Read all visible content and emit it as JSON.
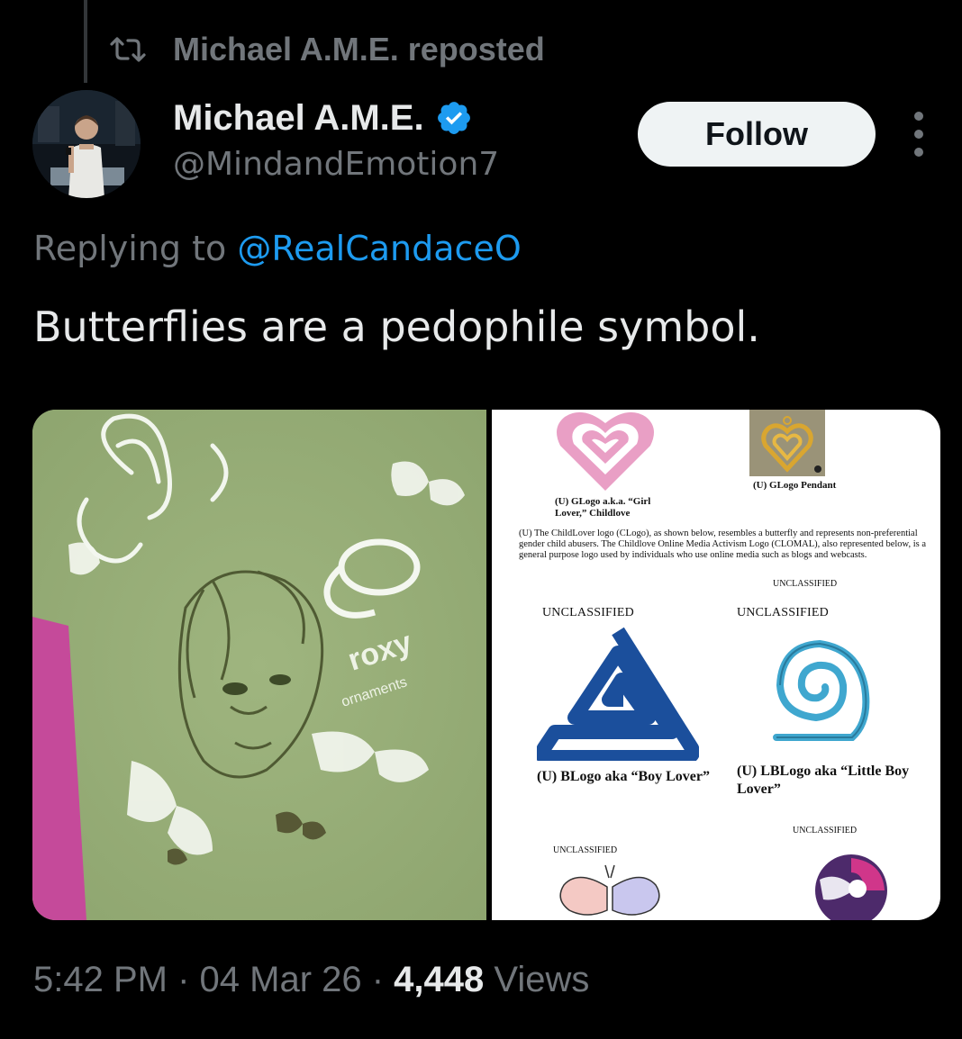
{
  "repost": {
    "text": "Michael A.M.E. reposted"
  },
  "author": {
    "display_name": "Michael A.M.E.",
    "handle": "@MindandEmotion7"
  },
  "follow_label": "Follow",
  "reply": {
    "prefix": "Replying to ",
    "mention": "@RealCandaceO"
  },
  "tweet_text": "Butterflies are a pedophile symbol.",
  "media": {
    "right": {
      "caption_glogo": "(U) GLogo a.k.a. “Girl Lover,” Childlove",
      "caption_pendant": "(U) GLogo Pendant",
      "paragraph": "(U) The ChildLover logo (CLogo), as shown below, resembles a butterfly and represents non-preferential gender child abusers. The Childlove Online Media Activism Logo (CLOMAL), also represented below, is a general purpose logo used by individuals who use online media such as blogs and webcasts.",
      "unclassified_small_1": "UNCLASSIFIED",
      "unclassified_left": "UNCLASSIFIED",
      "unclassified_right": "UNCLASSIFIED",
      "blogo_label": "(U) BLogo aka “Boy Lover”",
      "lblogo_label": "(U) LBLogo aka “Little Boy Lover”",
      "unclassified_small_2": "UNCLASSIFIED",
      "unclassified_small_3": "UNCLASSIFIED"
    }
  },
  "footer": {
    "time": "5:42 PM",
    "sep1": " · ",
    "date": "04 Mar 26",
    "sep2": " · ",
    "views_count": "4,448",
    "views_label": " Views"
  },
  "colors": {
    "background": "#000000",
    "text_primary": "#e7e9ea",
    "text_secondary": "#71767b",
    "link": "#1d9bf0",
    "verified": "#1d9bf0",
    "follow_bg": "#eff3f4"
  },
  "icons": {
    "repost": "repost-icon",
    "verified": "verified-badge-icon",
    "more": "more-options-icon"
  }
}
